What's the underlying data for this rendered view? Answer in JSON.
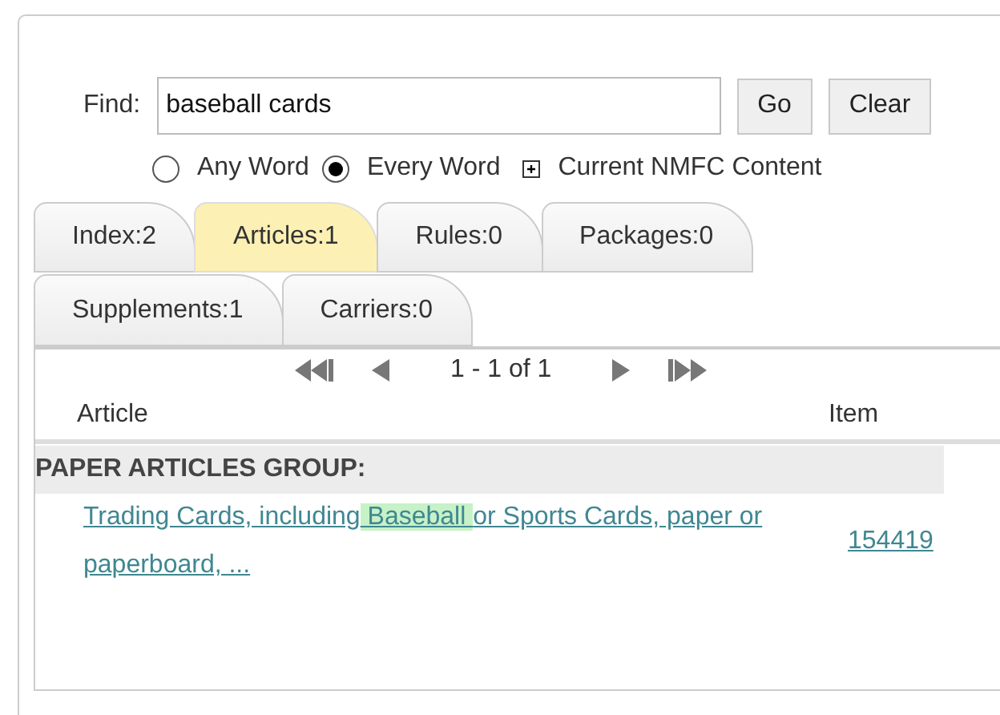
{
  "search": {
    "label": "Find:",
    "value": "baseball cards",
    "buttons": [
      "Go",
      "Clear"
    ]
  },
  "match_options": [
    {
      "label": "Any Word",
      "selected": false
    },
    {
      "label": "Every Word",
      "selected": true
    }
  ],
  "content_toggle": {
    "label": "Current NMFC Content"
  },
  "tab_rows": [
    [
      {
        "label": "Index:2",
        "selected": false
      },
      {
        "label": "Articles:1",
        "selected": true
      },
      {
        "label": "Rules:0",
        "selected": false
      },
      {
        "label": "Packages:0",
        "selected": false
      }
    ],
    [
      {
        "label": "Supplements:1",
        "selected": false
      },
      {
        "label": "Carriers:0",
        "selected": false
      }
    ]
  ],
  "pager": {
    "range": "1 - 1 of 1"
  },
  "table": {
    "columns": [
      "Article",
      "Item"
    ],
    "groups": [
      {
        "title": "PAPER ARTICLES GROUP:",
        "rows": [
          {
            "article_parts": [
              {
                "text": "Trading Cards, including",
                "highlighted": false
              },
              {
                "text": " Baseball ",
                "highlighted": true
              },
              {
                "text": "or Sports Cards, paper or paperboard,  ...",
                "highlighted": false
              }
            ],
            "item": "154419"
          }
        ]
      }
    ]
  }
}
